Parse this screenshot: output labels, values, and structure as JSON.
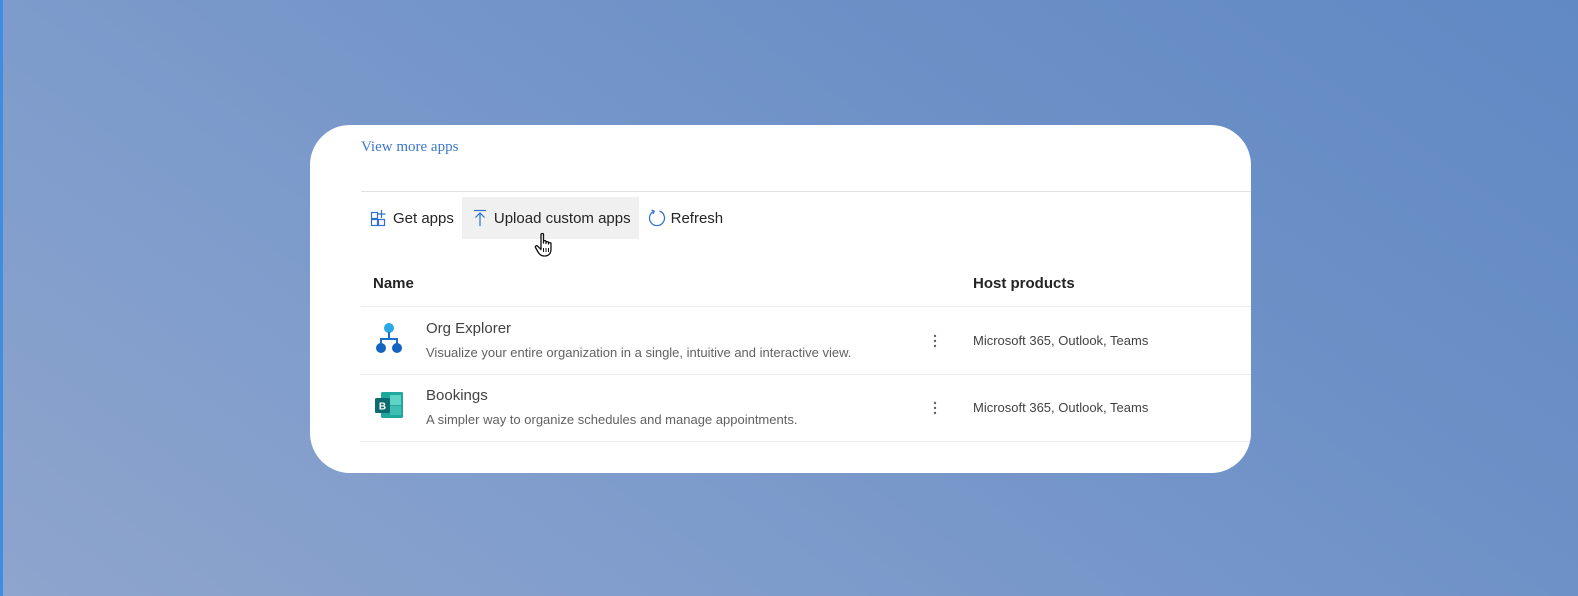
{
  "links": {
    "view_more": "View more apps"
  },
  "toolbar": {
    "get_apps": "Get apps",
    "upload": "Upload custom apps",
    "refresh": "Refresh"
  },
  "table": {
    "headers": {
      "name": "Name",
      "host": "Host products"
    },
    "rows": [
      {
        "name": "Org Explorer",
        "description": "Visualize your entire organization in a single, intuitive and interactive view.",
        "host": "Microsoft 365, Outlook, Teams",
        "icon": "org-explorer-icon"
      },
      {
        "name": "Bookings",
        "description": "A simpler way to organize schedules and manage appointments.",
        "host": "Microsoft 365, Outlook, Teams",
        "icon": "bookings-icon"
      }
    ]
  },
  "bookings_icon_letter": "B",
  "colors": {
    "link": "#3a78c9",
    "accent": "#2f6fcf",
    "background_start": "#8ea5cd",
    "background_end": "#6189c4"
  }
}
